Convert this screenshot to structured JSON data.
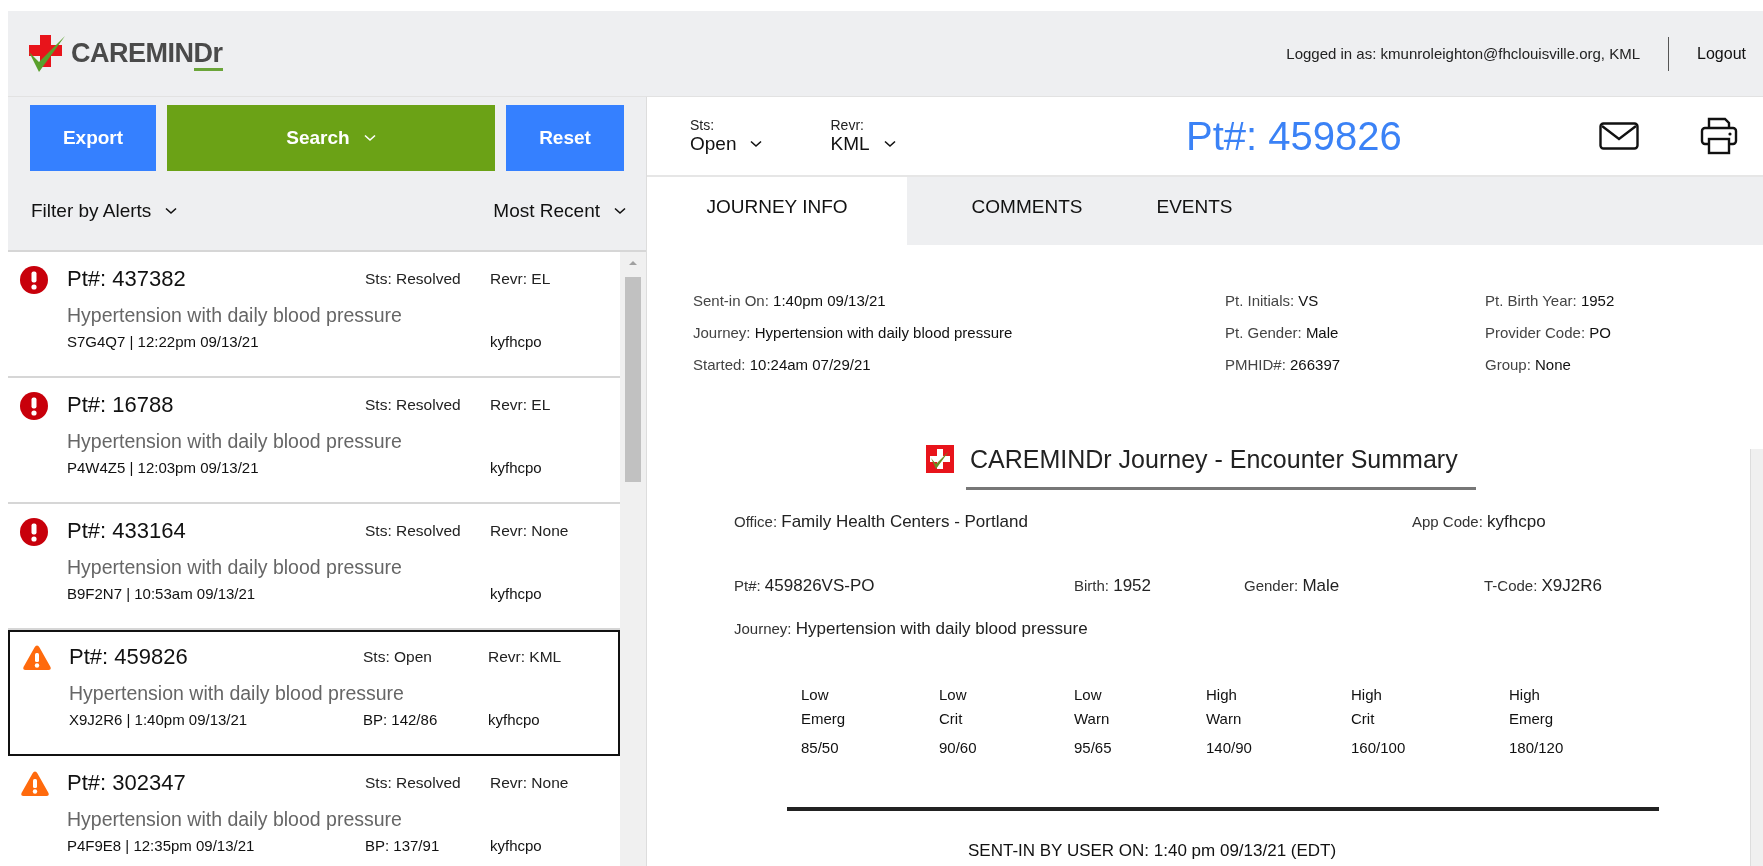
{
  "header": {
    "logo": {
      "text": "CAREMIN",
      "accent": "Dr"
    },
    "login": "Logged in as: kmunroleighton@fhclouisville.org, KML",
    "logout": "Logout"
  },
  "left_panel": {
    "buttons": [
      {
        "label": "Export",
        "kind": "plain"
      },
      {
        "label": "Search",
        "kind": "dropdown"
      },
      {
        "label": "Reset",
        "kind": "plain"
      }
    ],
    "filters": [
      {
        "label": "Filter by Alerts"
      },
      {
        "label": "Most Recent"
      }
    ],
    "items": [
      {
        "kind": "critical",
        "pt": "Pt#: 437382",
        "status": "Sts: Resolved",
        "reviewer": "Revr: EL",
        "journey": "Hypertension with daily blood pressure",
        "code_time": "S7G4Q7 | 12:22pm 09/13/21",
        "app": "kyfhcpo",
        "selected": false
      },
      {
        "kind": "critical",
        "pt": "Pt#: 16788",
        "status": "Sts: Resolved",
        "reviewer": "Revr: EL",
        "journey": "Hypertension with daily blood pressure",
        "code_time": "P4W4Z5 | 12:03pm 09/13/21",
        "app": "kyfhcpo",
        "selected": false
      },
      {
        "kind": "critical",
        "pt": "Pt#: 433164",
        "status": "Sts: Resolved",
        "reviewer": "Revr: None",
        "journey": "Hypertension with daily blood pressure",
        "code_time": "B9F2N7 | 10:53am 09/13/21",
        "app": "kyfhcpo",
        "selected": false
      },
      {
        "kind": "warning",
        "pt": "Pt#: 459826",
        "status": "Sts: Open",
        "reviewer": "Revr: KML",
        "journey": "Hypertension with daily blood pressure",
        "code_time": "X9J2R6 | 1:40pm 09/13/21",
        "bp": "BP: 142/86",
        "app": "kyfhcpo",
        "selected": true
      },
      {
        "kind": "warning",
        "pt": "Pt#: 302347",
        "status": "Sts: Resolved",
        "reviewer": "Revr: None",
        "journey": "Hypertension with daily blood pressure",
        "code_time": "P4F9E8 | 12:35pm 09/13/21",
        "bp": "BP: 137/91",
        "app": "kyfhcpo",
        "selected": false
      }
    ]
  },
  "toolbar": {
    "selects": [
      {
        "label": "Sts:",
        "value": "Open"
      },
      {
        "label": "Revr:",
        "value": "KML"
      }
    ],
    "title": "Pt#: 459826"
  },
  "tabs": [
    {
      "label": "JOURNEY INFO",
      "selected": true
    },
    {
      "label": "COMMENTS",
      "selected": false
    },
    {
      "label": "EVENTS",
      "selected": false
    }
  ],
  "info": [
    [
      {
        "label": "Sent-in On:",
        "value": "1:40pm 09/13/21"
      },
      {
        "label": "Journey:",
        "value": "Hypertension with daily blood pressure"
      },
      {
        "label": "Started:",
        "value": "10:24am 07/29/21"
      }
    ],
    [
      {
        "label": "Pt. Initials:",
        "value": "VS"
      },
      {
        "label": "Pt. Gender:",
        "value": "Male"
      },
      {
        "label": "PMHID#:",
        "value": "266397"
      }
    ],
    [
      {
        "label": "Pt. Birth Year:",
        "value": "1952"
      },
      {
        "label": "Provider Code:",
        "value": "PO"
      },
      {
        "label": "Group:",
        "value": "None"
      }
    ]
  ],
  "summary": {
    "title": "CAREMINDr Journey - Encounter Summary",
    "rows": [
      [
        {
          "label": "Office:",
          "value": "Family Health Centers - Portland"
        },
        {
          "label": "App Code:",
          "value": "kyfhcpo"
        }
      ],
      [
        {
          "label": "Pt#:",
          "value": "459826VS-PO"
        },
        {
          "label": "Birth:",
          "value": "1952"
        },
        {
          "label": "Gender:",
          "value": "Male"
        },
        {
          "label": "T-Code:",
          "value": "X9J2R6"
        }
      ],
      [
        {
          "label": "Journey:",
          "value": "Hypertension with daily blood pressure"
        }
      ]
    ],
    "thresholds": [
      {
        "level": "Low",
        "type": "Emerg",
        "value": "85/50"
      },
      {
        "level": "Low",
        "type": "Crit",
        "value": "90/60"
      },
      {
        "level": "Low",
        "type": "Warn",
        "value": "95/65"
      },
      {
        "level": "High",
        "type": "Warn",
        "value": "140/90"
      },
      {
        "level": "High",
        "type": "Crit",
        "value": "160/100"
      },
      {
        "level": "High",
        "type": "Emerg",
        "value": "180/120"
      }
    ],
    "sent": "SENT-IN BY USER ON: 1:40 pm 09/13/21 (EDT)"
  }
}
